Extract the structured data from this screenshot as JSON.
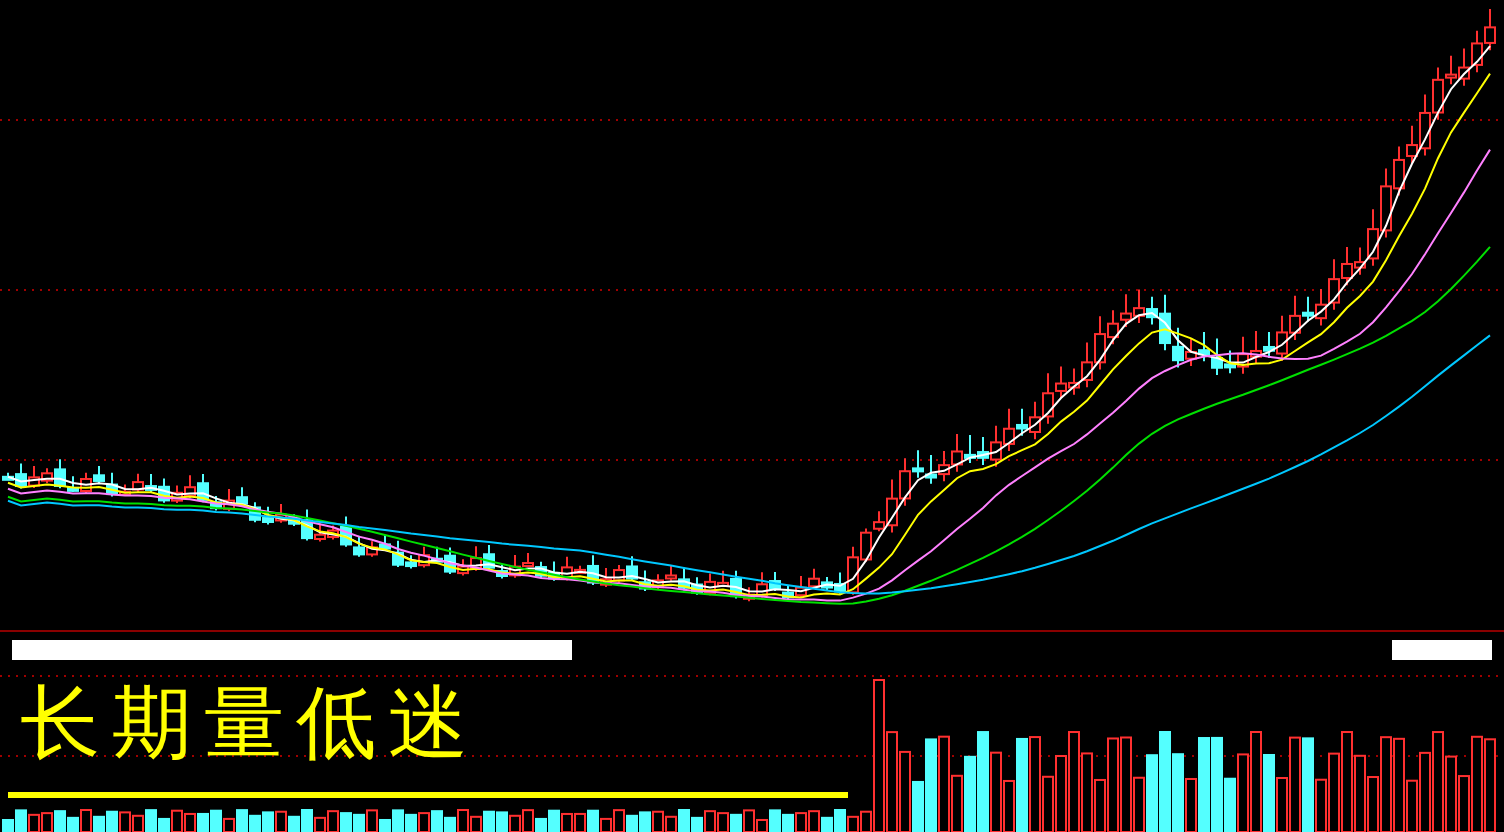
{
  "annotation": {
    "text": "长期量低迷"
  }
}
